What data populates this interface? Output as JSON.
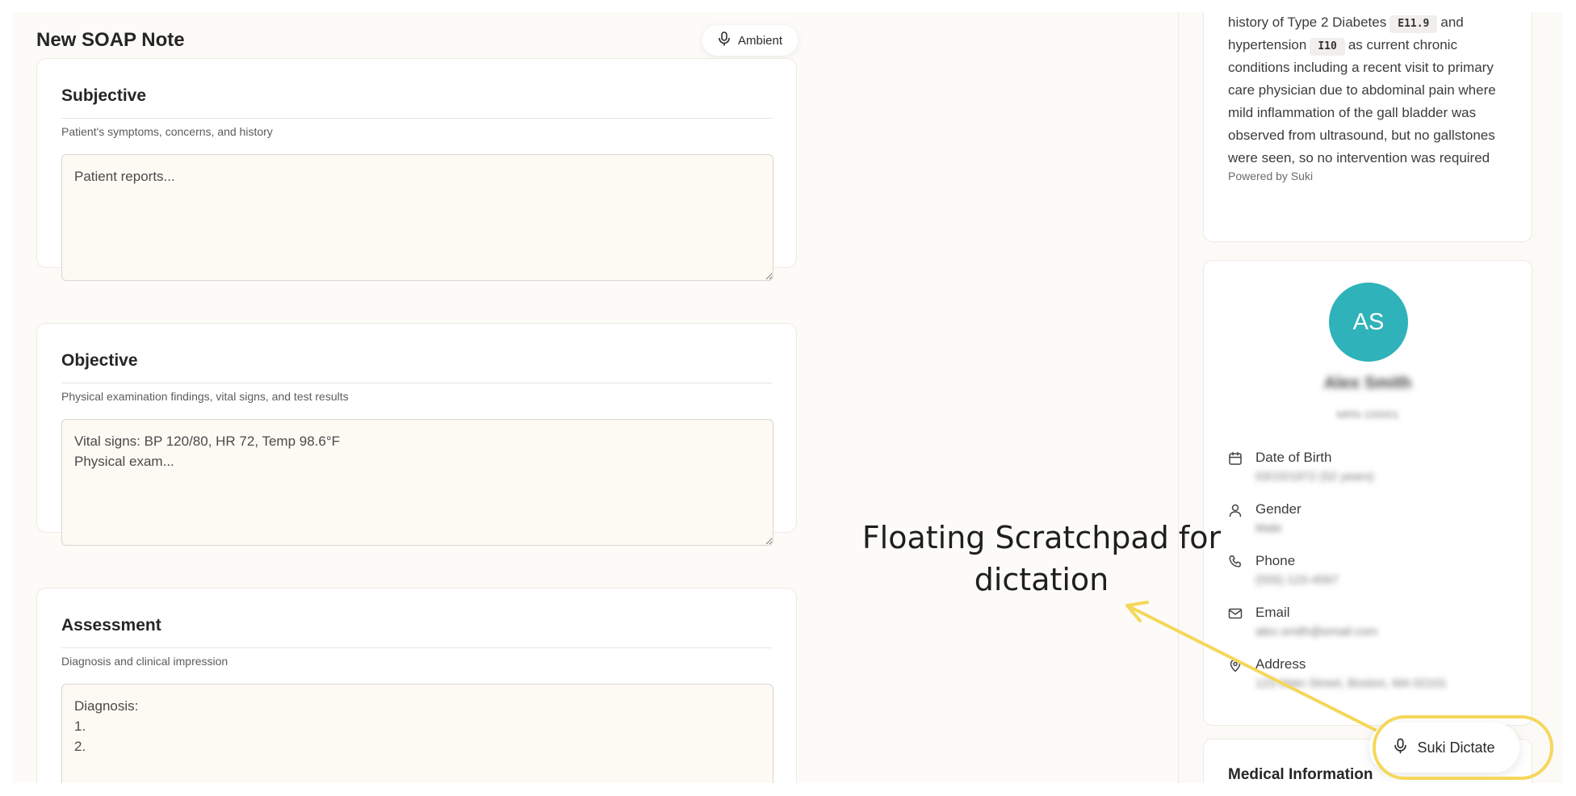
{
  "note": {
    "title": "New SOAP Note",
    "ambient_label": "Ambient",
    "sections": [
      {
        "title": "Subjective",
        "description": "Patient's symptoms, concerns, and history",
        "placeholder": "Patient reports...",
        "value": ""
      },
      {
        "title": "Objective",
        "description": "Physical examination findings, vital signs, and test results",
        "placeholder": "",
        "value": "Vital signs: BP 120/80, HR 72, Temp 98.6°F\nPhysical exam..."
      },
      {
        "title": "Assessment",
        "description": "Diagnosis and clinical impression",
        "placeholder": "",
        "value": "Diagnosis:\n1.\n2."
      }
    ]
  },
  "summary": {
    "text_1": "history of Type 2 Diabetes",
    "code_1": "E11.9",
    "text_2": "and hypertension",
    "code_2": "I10",
    "text_3": "as current chronic conditions including a recent visit to primary care physician due to abdominal pain where mild inflammation of the gall bladder was observed from ultrasound, but no gallstones were seen, so no intervention was required",
    "powered_by": "Powered by Suki"
  },
  "patient": {
    "initials": "AS",
    "name": "Alex Smith",
    "mrn": "MRN-100001",
    "details": [
      {
        "label": "Date of Birth",
        "value": "03/15/1972 (52 years)",
        "icon": "calendar-icon"
      },
      {
        "label": "Gender",
        "value": "Male",
        "icon": "person-icon"
      },
      {
        "label": "Phone",
        "value": "(555) 123-4567",
        "icon": "phone-icon"
      },
      {
        "label": "Email",
        "value": "alex.smith@email.com",
        "icon": "mail-icon"
      },
      {
        "label": "Address",
        "value": "123 Main Street, Boston, MA 02101",
        "icon": "map-pin-icon"
      }
    ]
  },
  "medical": {
    "title": "Medical Information"
  },
  "dictate": {
    "label": "Suki Dictate"
  },
  "annotation": {
    "text": "Floating Scratchpad for dictation",
    "color": "#f5d75a"
  },
  "colors": {
    "avatar": "#2fb2b9",
    "highlight": "#f5d75a",
    "background": "#fdfbf8"
  }
}
